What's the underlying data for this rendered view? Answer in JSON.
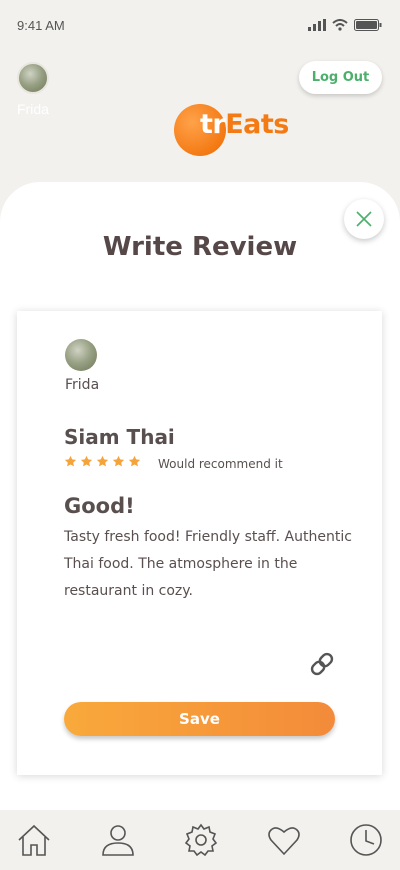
{
  "status_bar": {
    "time": "9:41 AM"
  },
  "header": {
    "user_name": "Frida",
    "logout_label": "Log Out",
    "logo": {
      "part1": "tr",
      "part2": "Eats"
    }
  },
  "sheet": {
    "title": "Write Review"
  },
  "review": {
    "user_name": "Frida",
    "restaurant": "Siam Thai",
    "rating": 5,
    "rating_max": 5,
    "recommend_text": "Would recommend it",
    "title": "Good!",
    "body": "Tasty fresh food! Friendly staff. Authentic Thai food. The atmosphere in the restaurant in cozy.",
    "save_label": "Save"
  },
  "icons": {
    "close": "close-icon",
    "link": "link-icon",
    "nav": [
      "home-icon",
      "profile-icon",
      "settings-icon",
      "favorites-icon",
      "history-icon"
    ]
  },
  "colors": {
    "accent_orange": "#f47a14",
    "star": "#f6a33a",
    "green": "#4caf6b",
    "text": "#5a4f4f"
  }
}
